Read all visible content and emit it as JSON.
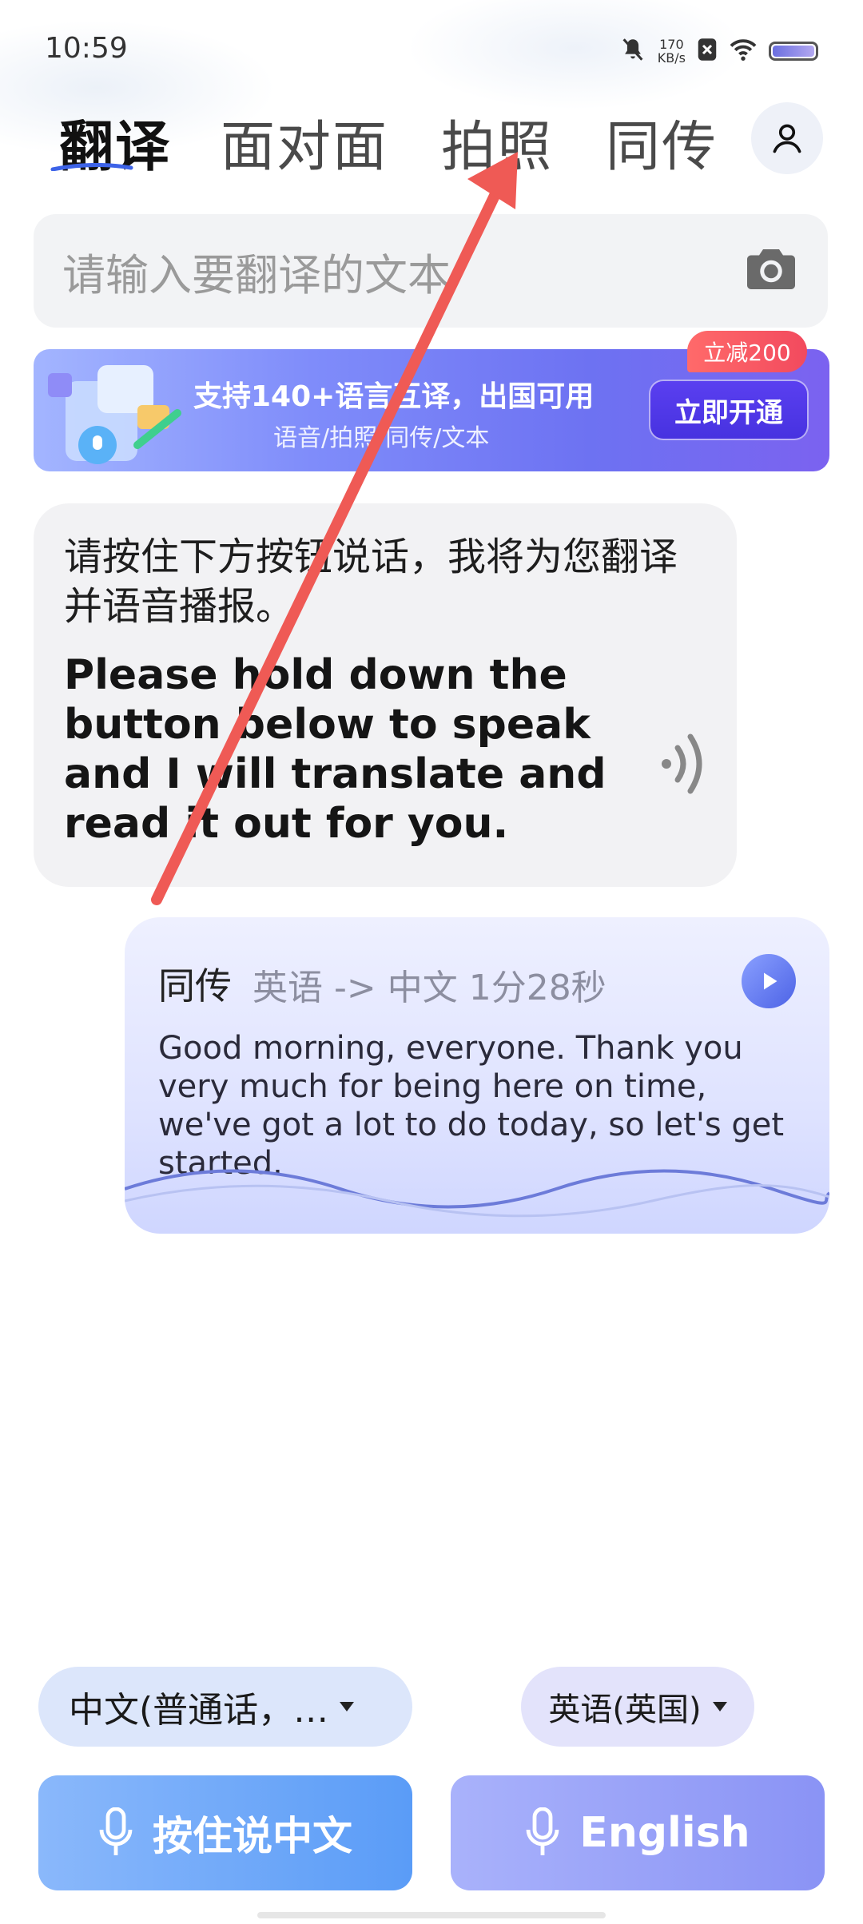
{
  "status_bar": {
    "time": "10:59",
    "net_speed_value": "170",
    "net_speed_unit": "KB/s"
  },
  "tabs": [
    {
      "label": "翻译",
      "active": true
    },
    {
      "label": "面对面",
      "active": false
    },
    {
      "label": "拍照",
      "active": false
    },
    {
      "label": "同传",
      "active": false
    }
  ],
  "search": {
    "placeholder": "请输入要翻译的文本"
  },
  "promo": {
    "title": "支持140+语言互译，出国可用",
    "subtitle": "语音/拍照/同传/文本",
    "button_label": "立即开通",
    "badge": "立减200"
  },
  "intro_message": {
    "chinese": "请按住下方按钮说话，我将为您翻译并语音播报。",
    "english": "Please hold down the button below to speak and I will translate and read it out for you."
  },
  "session_card": {
    "type_label": "同传",
    "meta": "英语 -> 中文 1分28秒",
    "text": "Good morning, everyone. Thank you very much for being here on time, we've got a lot to do today, so let's get started."
  },
  "language_selectors": {
    "source": "中文(普通话，…",
    "target": "英语(英国)"
  },
  "talk_buttons": {
    "chinese_label": "按住说中文",
    "english_label": "English"
  },
  "colors": {
    "accent": "#5a9cf7",
    "annotation_arrow": "#ef5a55",
    "brand_purple": "#6d72f2"
  }
}
